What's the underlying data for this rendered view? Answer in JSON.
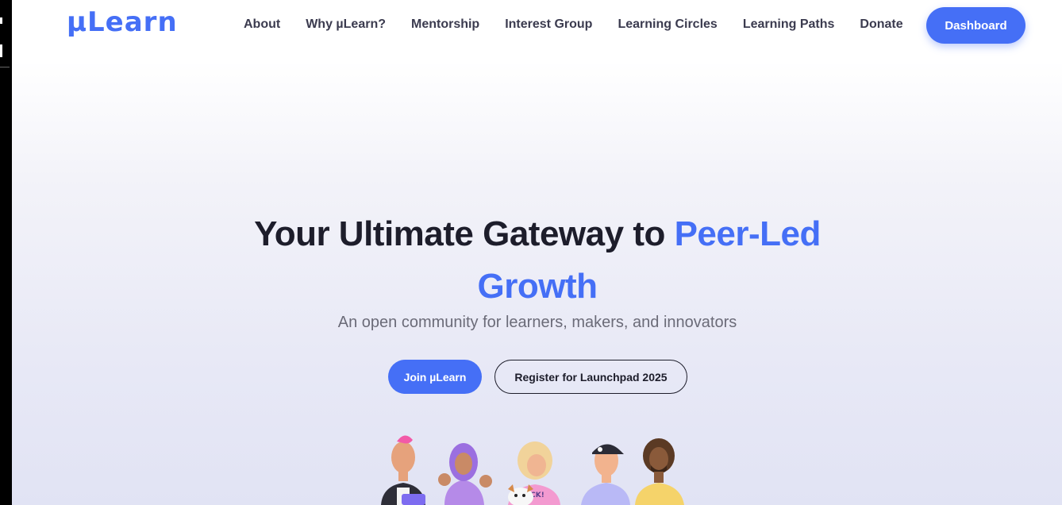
{
  "brand": {
    "logo_text": "µLearn",
    "accent_color": "#456ff6"
  },
  "nav": {
    "links": [
      {
        "label": "About"
      },
      {
        "label": "Why µLearn?"
      },
      {
        "label": "Mentorship"
      },
      {
        "label": "Interest Group"
      },
      {
        "label": "Learning Circles"
      },
      {
        "label": "Learning Paths"
      },
      {
        "label": "Donate"
      }
    ],
    "dashboard_label": "Dashboard"
  },
  "hero": {
    "title_main": "Your Ultimate Gateway to ",
    "title_accent": "Peer-Led Growth",
    "subtitle": "An open community for learners, makers, and innovators",
    "primary_cta": "Join µLearn",
    "secondary_cta": "Register for Launchpad 2025",
    "illustration_icon": "community-characters-illustration"
  }
}
